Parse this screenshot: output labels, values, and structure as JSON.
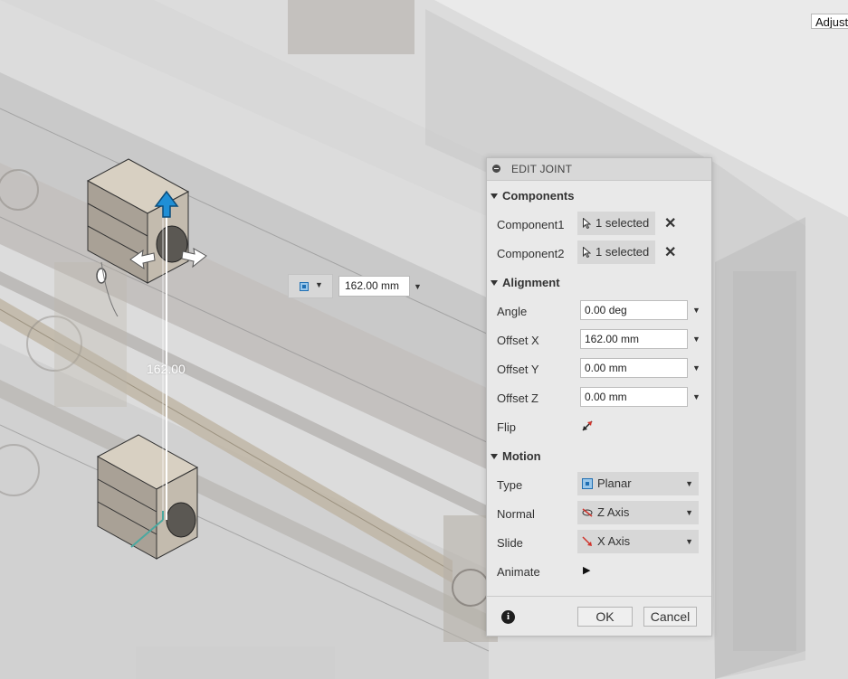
{
  "toolbar": {
    "adjust_label": "Adjust"
  },
  "canvas": {
    "dimension_label": "162.00",
    "float_input_value": "162.00 mm"
  },
  "dialog": {
    "title": "EDIT JOINT",
    "sections": {
      "components": "Components",
      "alignment": "Alignment",
      "motion": "Motion"
    },
    "component1": {
      "label": "Component1",
      "value": "1 selected"
    },
    "component2": {
      "label": "Component2",
      "value": "1 selected"
    },
    "angle": {
      "label": "Angle",
      "value": "0.00 deg"
    },
    "offset_x": {
      "label": "Offset X",
      "value": "162.00 mm"
    },
    "offset_y": {
      "label": "Offset Y",
      "value": "0.00 mm"
    },
    "offset_z": {
      "label": "Offset Z",
      "value": "0.00 mm"
    },
    "flip": {
      "label": "Flip"
    },
    "type": {
      "label": "Type",
      "value": "Planar"
    },
    "normal": {
      "label": "Normal",
      "value": "Z Axis"
    },
    "slide": {
      "label": "Slide",
      "value": "X Axis"
    },
    "animate": {
      "label": "Animate"
    },
    "ok_label": "OK",
    "cancel_label": "Cancel"
  },
  "colors": {
    "canvas_bg": "#e9e9e9",
    "manipulator_blue": "#1f8fd6",
    "dialog_bg": "#e9e9e9"
  }
}
